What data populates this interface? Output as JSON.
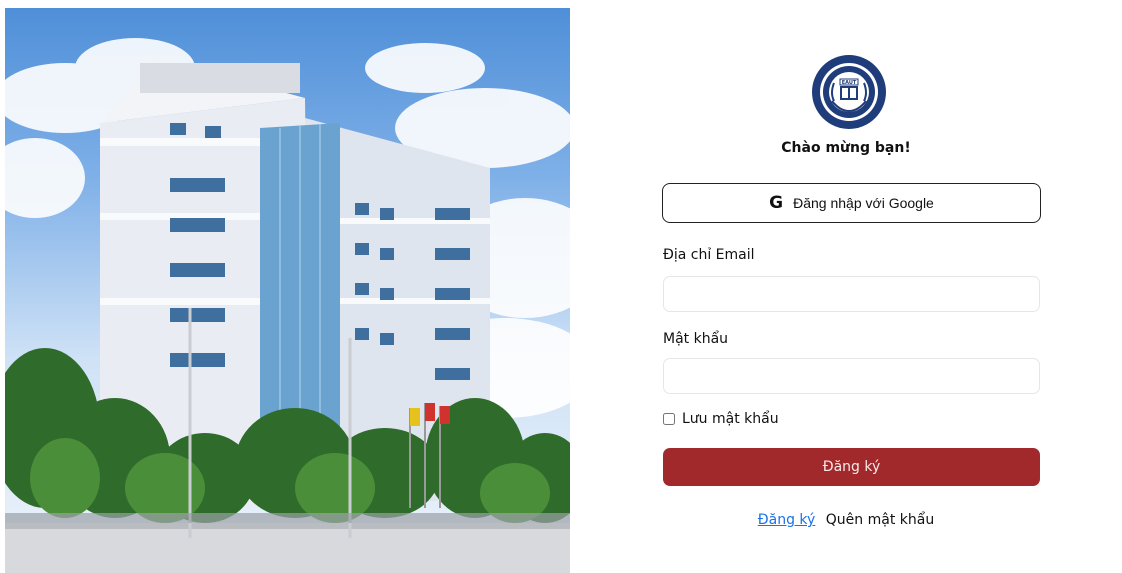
{
  "login": {
    "welcome": "Chào mừng bạn!",
    "google_button": "Đăng nhập với Google",
    "google_icon": "G",
    "email_label": "Địa chỉ Email",
    "email_value": "",
    "password_label": "Mật khẩu",
    "password_value": "",
    "remember_label": "Lưu mật khẩu",
    "remember_checked": false,
    "submit_button": "Đăng ký",
    "register_link": "Đăng ký",
    "forgot_link": "Quên mật khẩu"
  },
  "logo": {
    "top_text": "TRƯỜNG ĐẠI HỌC CÔNG NGHỆ ĐÔNG Á",
    "bottom_text": "EASTASIA UNIVERSITY OF TECHNOLOGY",
    "center_text": "EAUT"
  },
  "colors": {
    "primary": "#a2292b",
    "link": "#1a73e8",
    "logo_navy": "#1f3d7a"
  }
}
